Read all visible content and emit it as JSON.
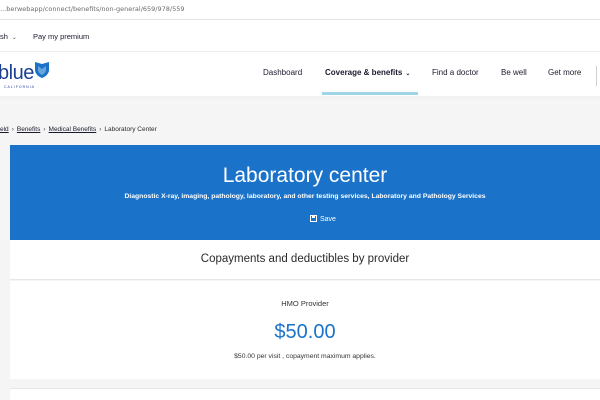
{
  "browser": {
    "url": "...berwebapp/connect/benefits/non-general/659/978/559"
  },
  "utility_bar": {
    "language_label": "sh",
    "pay_premium_label": "Pay my premium"
  },
  "header": {
    "logo_word": "blue",
    "logo_subtext": "CALIFORNIA",
    "nav": [
      {
        "label": "Dashboard"
      },
      {
        "label": "Coverage & benefits"
      },
      {
        "label": "Find a doctor"
      },
      {
        "label": "Be well"
      },
      {
        "label": "Get more"
      }
    ]
  },
  "breadcrumb": {
    "items": [
      "eld",
      "Benefits",
      "Medical Benefits"
    ],
    "current": "Laboratory Center"
  },
  "hero": {
    "title": "Laboratory center",
    "description": "Diagnostic X-ray, imaging, pathology, laboratory, and other testing services, Laboratory and Pathology Services",
    "save_label": "Save"
  },
  "copay_section": {
    "heading": "Copayments and deductibles by provider"
  },
  "provider_card": {
    "provider": "HMO Provider",
    "amount": "$50.00",
    "note": "$50.00 per visit , copayment maximum applies."
  },
  "colors": {
    "brand_blue": "#1c3f94",
    "hero_blue": "#1a73c9",
    "active_underline": "#9fd3e8"
  },
  "icons": [
    "chevron-down-icon",
    "shield-logo-icon",
    "save-icon"
  ]
}
